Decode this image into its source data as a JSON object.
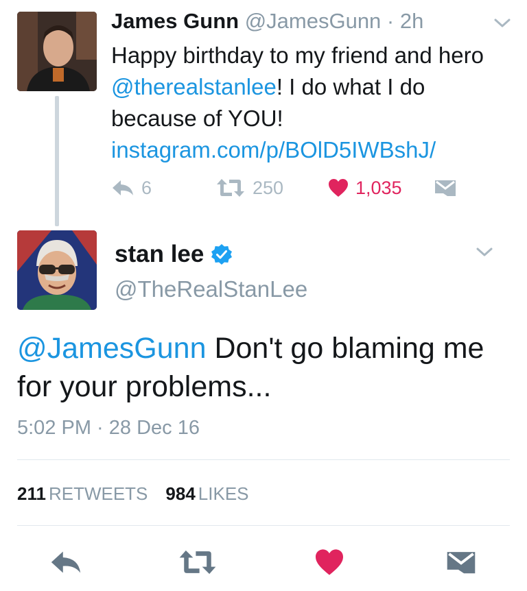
{
  "parent_tweet": {
    "author_name": "James Gunn",
    "handle": "@JamesGunn",
    "separator": "·",
    "time_ago": "2h",
    "text_before_mention": "Happy birthday to my friend and hero ",
    "mention": "@therealstanlee",
    "text_after_mention": "! I do what I do because of YOU! ",
    "link": "instagram.com/p/BOlD5IWBshJ/",
    "reply_count": "6",
    "retweet_count": "250",
    "like_count": "1,035",
    "icons": [
      "reply-icon",
      "retweet-icon",
      "heart-icon",
      "direct-message-icon"
    ]
  },
  "main_tweet": {
    "author_name": "stan lee",
    "handle": "@TheRealStanLee",
    "mention": "@JamesGunn",
    "text": " Don't go blaming me for your problems...",
    "timestamp": "5:02 PM · 28 Dec 16",
    "retweets_count": "211",
    "retweets_label": "RETWEETS",
    "likes_count": "984",
    "likes_label": "LIKES",
    "icons": [
      "reply-icon",
      "retweet-icon",
      "heart-icon",
      "direct-message-icon"
    ]
  },
  "colors": {
    "link": "#1b95e0",
    "muted": "#8899a6",
    "icon_gray": "#aab8c2",
    "action_gray": "#657786",
    "like_red": "#e0245e",
    "verified_blue": "#1da1f2"
  }
}
